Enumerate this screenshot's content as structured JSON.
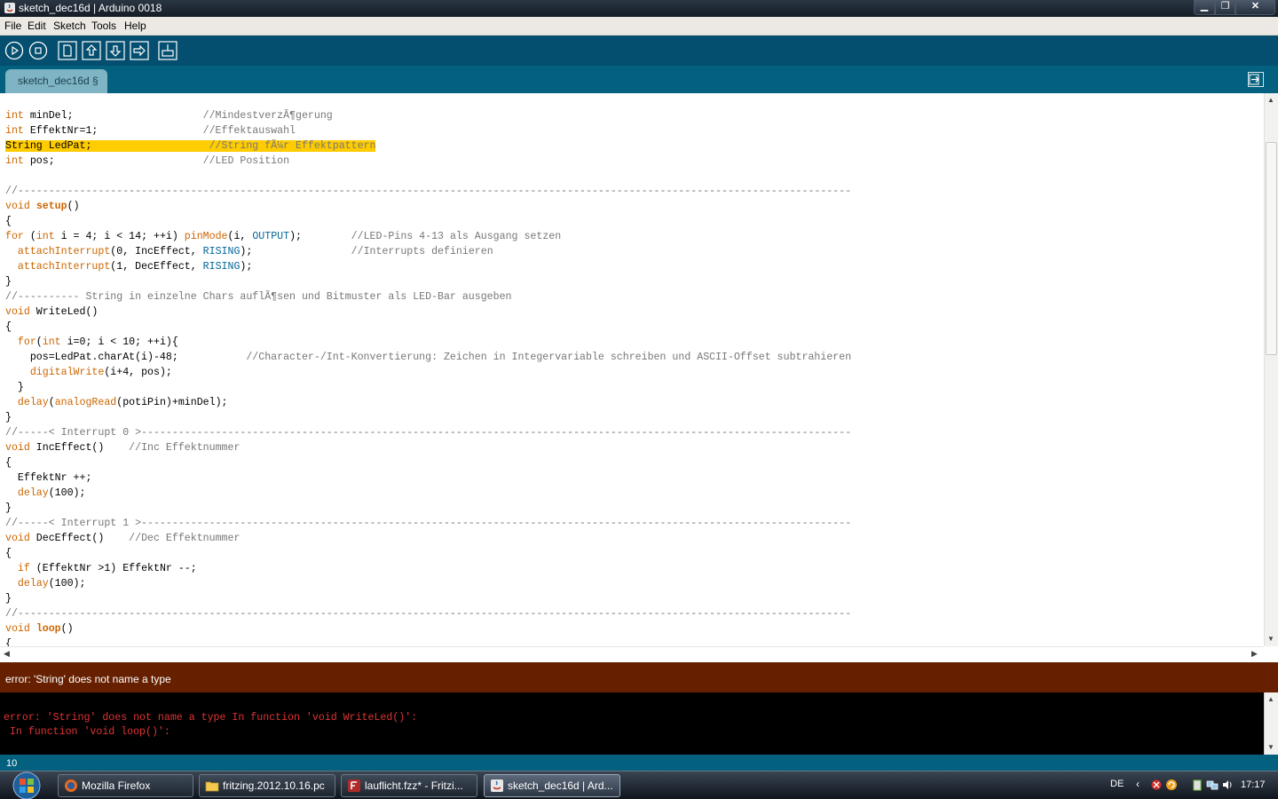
{
  "window": {
    "title": "sketch_dec16d | Arduino 0018"
  },
  "menu": [
    "File",
    "Edit",
    "Sketch",
    "Tools",
    "Help"
  ],
  "toolbar": [
    "verify",
    "stop",
    "new",
    "open",
    "save",
    "upload",
    "serial-monitor"
  ],
  "tab": {
    "label": "sketch_dec16d §"
  },
  "code": [
    [
      [
        "kw",
        "int"
      ],
      [
        "t",
        " minDel;                     "
      ],
      [
        "cm",
        "//MindestverzÃ¶gerung"
      ]
    ],
    [
      [
        "kw",
        "int"
      ],
      [
        "t",
        " EffektNr=1;                 "
      ],
      [
        "cm",
        "//Effektauswahl"
      ]
    ],
    [
      [
        "hl",
        "String LedPat;                   "
      ],
      [
        "hlc",
        "//String fÃ¼r Effektpattern"
      ]
    ],
    [
      [
        "kw",
        "int"
      ],
      [
        "t",
        " pos;                        "
      ],
      [
        "cm",
        "//LED Position"
      ]
    ],
    [],
    [
      [
        "cm",
        "//---------------------------------------------------------------------------------------------------------------------------------------"
      ]
    ],
    [
      [
        "kw",
        "void"
      ],
      [
        "t",
        " "
      ],
      [
        "fn",
        "setup"
      ],
      [
        "t",
        "()"
      ]
    ],
    [
      [
        "t",
        "{"
      ]
    ],
    [
      [
        "kw",
        "for"
      ],
      [
        "t",
        " ("
      ],
      [
        "kw",
        "int"
      ],
      [
        "t",
        " i = 4; i < 14; ++i) "
      ],
      [
        "kw",
        "pinMode"
      ],
      [
        "t",
        "(i, "
      ],
      [
        "cst",
        "OUTPUT"
      ],
      [
        "t",
        ");        "
      ],
      [
        "cm",
        "//LED-Pins 4-13 als Ausgang setzen"
      ]
    ],
    [
      [
        "t",
        "  "
      ],
      [
        "kw",
        "attachInterrupt"
      ],
      [
        "t",
        "(0, IncEffect, "
      ],
      [
        "cst",
        "RISING"
      ],
      [
        "t",
        ");                "
      ],
      [
        "cm",
        "//Interrupts definieren"
      ]
    ],
    [
      [
        "t",
        "  "
      ],
      [
        "kw",
        "attachInterrupt"
      ],
      [
        "t",
        "(1, DecEffect, "
      ],
      [
        "cst",
        "RISING"
      ],
      [
        "t",
        ");"
      ]
    ],
    [
      [
        "t",
        "}"
      ]
    ],
    [
      [
        "cm",
        "//---------- String in einzelne Chars auflÃ¶sen und Bitmuster als LED-Bar ausgeben"
      ]
    ],
    [
      [
        "kw",
        "void"
      ],
      [
        "t",
        " WriteLed()"
      ]
    ],
    [
      [
        "t",
        "{"
      ]
    ],
    [
      [
        "t",
        "  "
      ],
      [
        "kw",
        "for"
      ],
      [
        "t",
        "("
      ],
      [
        "kw",
        "int"
      ],
      [
        "t",
        " i=0; i < 10; ++i){"
      ]
    ],
    [
      [
        "t",
        "    pos=LedPat.charAt(i)-48;           "
      ],
      [
        "cm",
        "//Character-/Int-Konvertierung: Zeichen in Integervariable schreiben und ASCII-Offset subtrahieren"
      ]
    ],
    [
      [
        "t",
        "    "
      ],
      [
        "kw",
        "digitalWrite"
      ],
      [
        "t",
        "(i+4, pos);"
      ]
    ],
    [
      [
        "t",
        "  }"
      ]
    ],
    [
      [
        "t",
        "  "
      ],
      [
        "kw",
        "delay"
      ],
      [
        "t",
        "("
      ],
      [
        "kw",
        "analogRead"
      ],
      [
        "t",
        "(potiPin)+minDel);"
      ]
    ],
    [
      [
        "t",
        "}"
      ]
    ],
    [
      [
        "cm",
        "//-----< Interrupt 0 >-------------------------------------------------------------------------------------------------------------------"
      ]
    ],
    [
      [
        "kw",
        "void"
      ],
      [
        "t",
        " IncEffect()    "
      ],
      [
        "cm",
        "//Inc Effektnummer"
      ]
    ],
    [
      [
        "t",
        "{"
      ]
    ],
    [
      [
        "t",
        "  EffektNr ++;"
      ]
    ],
    [
      [
        "t",
        "  "
      ],
      [
        "kw",
        "delay"
      ],
      [
        "t",
        "(100);"
      ]
    ],
    [
      [
        "t",
        "}"
      ]
    ],
    [
      [
        "cm",
        "//-----< Interrupt 1 >-------------------------------------------------------------------------------------------------------------------"
      ]
    ],
    [
      [
        "kw",
        "void"
      ],
      [
        "t",
        " DecEffect()    "
      ],
      [
        "cm",
        "//Dec Effektnummer"
      ]
    ],
    [
      [
        "t",
        "{"
      ]
    ],
    [
      [
        "t",
        "  "
      ],
      [
        "kw",
        "if"
      ],
      [
        "t",
        " (EffektNr >1) EffektNr --;"
      ]
    ],
    [
      [
        "t",
        "  "
      ],
      [
        "kw",
        "delay"
      ],
      [
        "t",
        "(100);"
      ]
    ],
    [
      [
        "t",
        "}"
      ]
    ],
    [
      [
        "cm",
        "//---------------------------------------------------------------------------------------------------------------------------------------"
      ]
    ],
    [
      [
        "kw",
        "void"
      ],
      [
        "t",
        " "
      ],
      [
        "fn",
        "loop"
      ],
      [
        "t",
        "()"
      ]
    ],
    [
      [
        "t",
        "{"
      ]
    ]
  ],
  "status": {
    "message": "error: 'String' does not name a type"
  },
  "console": [
    "error: 'String' does not name a type In function 'void WriteLed()':",
    " In function 'void loop()':"
  ],
  "line_number": "10",
  "taskbar": {
    "tasks": [
      {
        "label": "Mozilla Firefox",
        "icon": "firefox-icon",
        "active": false
      },
      {
        "label": "fritzing.2012.10.16.pc",
        "icon": "folder-icon",
        "active": false
      },
      {
        "label": "lauflicht.fzz* - Fritzi...",
        "icon": "fritzing-icon",
        "active": false
      },
      {
        "label": "sketch_dec16d | Ard...",
        "icon": "java-icon",
        "active": true
      }
    ],
    "language": "DE",
    "clock": "17:17"
  },
  "colors": {
    "toolbar": "#044f6f",
    "tabstrip": "#04607f",
    "tab": "#7eb4c3",
    "keyword": "#cc6600",
    "constant": "#006699",
    "comment": "#777777",
    "highlight": "#ffcc00",
    "status_error": "#662000",
    "console_text": "#e13333"
  }
}
